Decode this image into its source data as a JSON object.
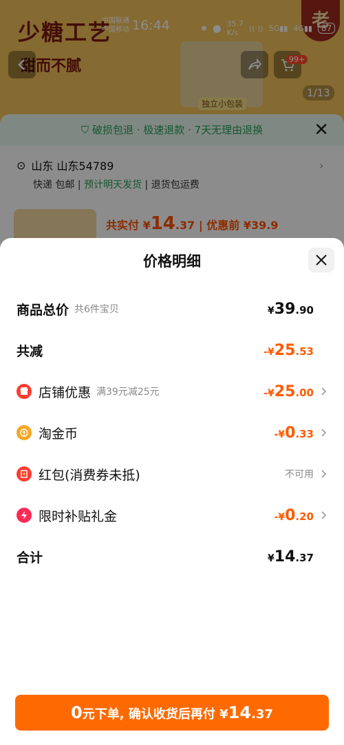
{
  "status_bar": {
    "carrier_1": "中国联通",
    "carrier_2": "中国移动",
    "time": "16:44",
    "speed": "35.7",
    "speed_unit": "K/s",
    "battery": "87"
  },
  "background": {
    "brand": "少糖工艺",
    "slogan": "甜而不腻",
    "cart_badge": "99+",
    "image_counter": "1/13",
    "seal_text": "老",
    "hero_tag": "独立小包装",
    "guarantee": "破损包退 · 极速退款 · 7天无理由退换",
    "address": "山东 山东54789",
    "delivery_1": "快递 包邮",
    "delivery_2": "预计明天发货",
    "delivery_3": "退货包运费",
    "paid_label": "共实付 ¥",
    "paid_int": "14",
    "paid_dec": ".37",
    "before_discount": "| 优惠前 ¥39.9"
  },
  "modal": {
    "title": "价格明细",
    "rows": [
      {
        "label": "商品总价",
        "sub": "共6件宝贝",
        "yen": "¥",
        "int": "39",
        "dec": ".90"
      },
      {
        "label": "共减",
        "yen": "-¥",
        "int": "25",
        "dec": ".53"
      },
      {
        "label": "店铺优惠",
        "sub": "满39元减25元",
        "yen": "-¥",
        "int": "25",
        "dec": ".00",
        "icon": "store-icon"
      },
      {
        "label": "淘金币",
        "yen": "-¥",
        "int": "0",
        "dec": ".33",
        "icon": "coin-icon"
      },
      {
        "label": "红包(消费券未抵)",
        "value_text": "不可用",
        "icon": "red-envelope-icon"
      },
      {
        "label": "限时补贴礼金",
        "yen": "-¥",
        "int": "0",
        "dec": ".20",
        "icon": "lightning-icon"
      },
      {
        "label": "合计",
        "yen": "¥",
        "int": "14",
        "dec": ".37"
      }
    ]
  },
  "cta": {
    "prefix_big": "0",
    "text": "元下单, 确认收货后再付 ¥",
    "int": "14",
    "dec": ".37"
  },
  "colors": {
    "accent_orange": "#ff5a00",
    "cta_orange": "#ff6a00",
    "green": "#27a05a"
  }
}
